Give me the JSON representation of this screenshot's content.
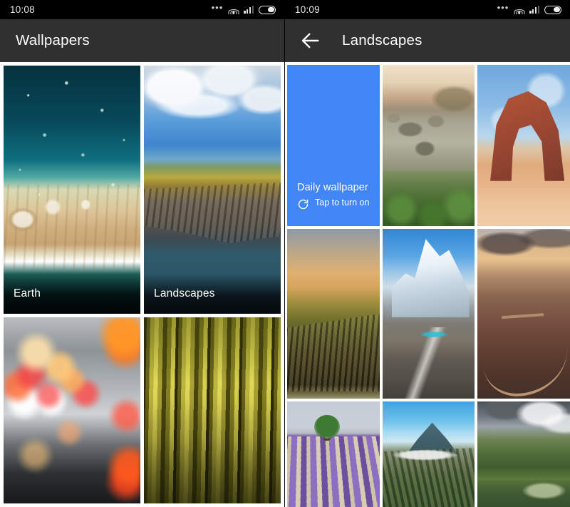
{
  "screens": [
    {
      "statusbar": {
        "time": "10:08",
        "dots": "•••",
        "wifi_icon": "wifi-icon",
        "signal_icon": "signal-icon",
        "battery_icon": "battery-icon"
      },
      "appbar": {
        "title": "Wallpapers",
        "has_back": false
      },
      "tiles": [
        {
          "label": "Earth",
          "art": "art-earth",
          "name": "wallpaper-category-earth"
        },
        {
          "label": "Landscapes",
          "art": "art-cliffs",
          "name": "wallpaper-category-landscapes"
        },
        {
          "label": "",
          "art": "art-bokeh",
          "name": "wallpaper-category-cityscapes"
        },
        {
          "label": "",
          "art": "art-birch",
          "name": "wallpaper-category-textures"
        }
      ]
    },
    {
      "statusbar": {
        "time": "10:09",
        "dots": "•••",
        "wifi_icon": "wifi-icon",
        "signal_icon": "signal-icon",
        "battery_icon": "battery-icon"
      },
      "appbar": {
        "title": "Landscapes",
        "has_back": true,
        "back_icon": "back-arrow-icon"
      },
      "daily": {
        "title": "Daily wallpaper",
        "subtitle": "Tap to turn on",
        "icon": "refresh-icon",
        "color": "#4285f4"
      },
      "tiles": [
        {
          "art": "art-lagoon",
          "name": "wallpaper-thumb-rocky-lagoon"
        },
        {
          "art": "art-arch",
          "name": "wallpaper-thumb-desert-arch"
        },
        {
          "art": "art-canyon",
          "name": "wallpaper-thumb-canyon-sunset"
        },
        {
          "art": "art-peak",
          "name": "wallpaper-thumb-snow-peak"
        },
        {
          "art": "art-road",
          "name": "wallpaper-thumb-winding-road"
        },
        {
          "art": "art-lavender",
          "name": "wallpaper-thumb-lavender-field"
        },
        {
          "art": "art-volcano",
          "name": "wallpaper-thumb-volcano"
        },
        {
          "art": "art-forest",
          "name": "wallpaper-thumb-green-mountain"
        }
      ]
    }
  ],
  "colors": {
    "appbar_bg": "#303030",
    "statusbar_bg": "#000000",
    "accent_blue": "#4285f4",
    "page_bg": "#ffffff"
  }
}
